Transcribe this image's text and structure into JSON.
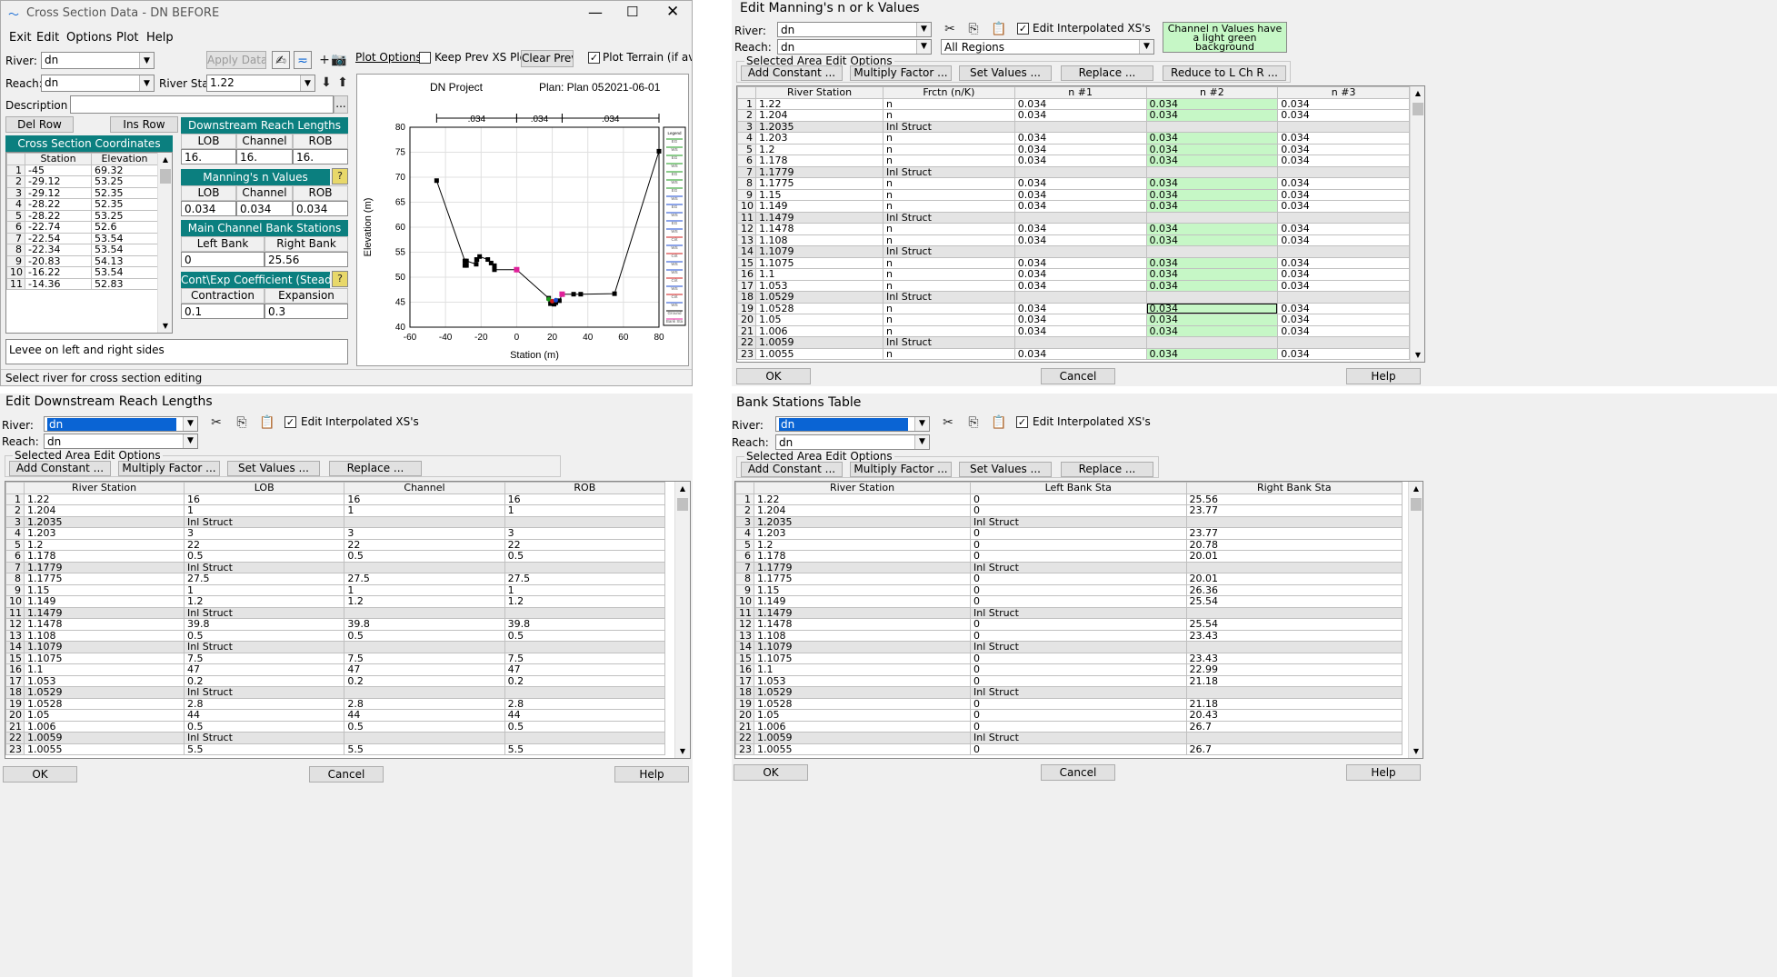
{
  "xs": {
    "title": "Cross Section Data - DN BEFORE",
    "menu": [
      "Exit",
      "Edit",
      "Options",
      "Plot",
      "Help"
    ],
    "river_label": "River:",
    "river": "dn",
    "reach_label": "Reach:",
    "reach": "dn",
    "river_sta_label": "River Sta.:",
    "river_sta": "1.22",
    "apply": "Apply Data",
    "plot_options": "Plot Options",
    "keep_prev": "Keep Prev XS Plots",
    "clear_prev": "Clear Prev",
    "plot_terrain": "Plot Terrain (if availab",
    "description_label": "Description",
    "del_row": "Del Row",
    "ins_row": "Ins Row",
    "coords_header": "Cross Section Coordinates",
    "coords_cols": [
      "Station",
      "Elevation"
    ],
    "coords": [
      [
        "-45",
        "69.32"
      ],
      [
        "-29.12",
        "53.25"
      ],
      [
        "-29.12",
        "52.35"
      ],
      [
        "-28.22",
        "52.35"
      ],
      [
        "-28.22",
        "53.25"
      ],
      [
        "-22.74",
        "52.6"
      ],
      [
        "-22.54",
        "53.54"
      ],
      [
        "-22.34",
        "53.54"
      ],
      [
        "-20.83",
        "54.13"
      ],
      [
        "-16.22",
        "53.54"
      ],
      [
        "-14.36",
        "52.83"
      ]
    ],
    "drl_header": "Downstream Reach Lengths",
    "drl_cols": [
      "LOB",
      "Channel",
      "ROB"
    ],
    "drl_vals": [
      "16.",
      "16.",
      "16."
    ],
    "mn_header": "Manning's n Values",
    "mn_cols": [
      "LOB",
      "Channel",
      "ROB"
    ],
    "mn_vals": [
      "0.034",
      "0.034",
      "0.034"
    ],
    "bank_header": "Main Channel Bank Stations",
    "bank_cols": [
      "Left Bank",
      "Right Bank"
    ],
    "bank_vals": [
      "0",
      "25.56"
    ],
    "ce_header": "Cont\\Exp Coefficient (Steady",
    "ce_cols": [
      "Contraction",
      "Expansion"
    ],
    "ce_vals": [
      "0.1",
      "0.3"
    ],
    "note": "Levee on left and right sides",
    "status": "Select river for cross section editing"
  },
  "chart_data": {
    "type": "line",
    "title_parts": [
      "DN Project",
      "Plan: Plan 05",
      "2021-06-01"
    ],
    "xlabel": "Station (m)",
    "ylabel": "Elevation (m)",
    "xlim": [
      -60,
      80
    ],
    "ylim": [
      40,
      80
    ],
    "xticks": [
      -60,
      -40,
      -20,
      0,
      20,
      40,
      60,
      80
    ],
    "yticks": [
      40,
      45,
      50,
      55,
      60,
      65,
      70,
      75,
      80
    ],
    "n_labels": [
      ".034",
      ".034",
      ".034"
    ],
    "n_breaks": [
      -45,
      0,
      25.56,
      80
    ],
    "grid": true,
    "legend": "right",
    "series": [
      {
        "x": [
          -45,
          -29.12,
          -29.12,
          -28.22,
          -28.22,
          -22.74,
          -22.54,
          -22.34,
          -20.83,
          -16.22,
          -14.36,
          -12.5,
          -12.5,
          0,
          18,
          19,
          20,
          21,
          22,
          24,
          25.56,
          32,
          36,
          55,
          80
        ],
        "y": [
          69.32,
          53.25,
          52.35,
          52.35,
          53.25,
          52.6,
          53.54,
          53.54,
          54.13,
          53.54,
          52.83,
          52.3,
          51.5,
          51.5,
          45.8,
          44.7,
          44.8,
          44.6,
          44.9,
          45.3,
          46.6,
          46.6,
          46.6,
          46.7,
          75.2
        ]
      }
    ],
    "bank_points_x": [
      0,
      25.56
    ],
    "legend_items": [
      "Legend",
      "EG",
      "WS",
      "EG",
      "WS",
      "EG",
      "WS",
      "EG",
      "WS",
      "EG",
      "WS",
      "EG",
      "WS",
      "Crit",
      "WS",
      "Crit",
      "WS",
      "WS",
      "Crit",
      "WS",
      "Crit",
      "WS",
      "Ground",
      "Bank Sta"
    ]
  },
  "mn": {
    "title": "Edit Manning's n or k Values",
    "river_label": "River:",
    "river": "dn",
    "reach_label": "Reach:",
    "reach": "dn",
    "edit_interp": "Edit Interpolated XS's",
    "regions": "All Regions",
    "note": "Channel n Values have a light green background",
    "sel_area": "Selected Area Edit Options",
    "buttons": [
      "Add Constant ...",
      "Multiply Factor ...",
      "Set Values ...",
      "Replace ...",
      "Reduce to L Ch R ..."
    ],
    "cols": [
      "River Station",
      "Frctn (n/K)",
      "n #1",
      "n #2",
      "n #3"
    ],
    "rows": [
      [
        "1.22",
        "n",
        "0.034",
        "0.034",
        "0.034"
      ],
      [
        "1.204",
        "n",
        "0.034",
        "0.034",
        "0.034"
      ],
      [
        "1.2035",
        "Inl Struct",
        "",
        "",
        ""
      ],
      [
        "1.203",
        "n",
        "0.034",
        "0.034",
        "0.034"
      ],
      [
        "1.2",
        "n",
        "0.034",
        "0.034",
        "0.034"
      ],
      [
        "1.178",
        "n",
        "0.034",
        "0.034",
        "0.034"
      ],
      [
        "1.1779",
        "Inl Struct",
        "",
        "",
        ""
      ],
      [
        "1.1775",
        "n",
        "0.034",
        "0.034",
        "0.034"
      ],
      [
        "1.15",
        "n",
        "0.034",
        "0.034",
        "0.034"
      ],
      [
        "1.149",
        "n",
        "0.034",
        "0.034",
        "0.034"
      ],
      [
        "1.1479",
        "Inl Struct",
        "",
        "",
        ""
      ],
      [
        "1.1478",
        "n",
        "0.034",
        "0.034",
        "0.034"
      ],
      [
        "1.108",
        "n",
        "0.034",
        "0.034",
        "0.034"
      ],
      [
        "1.1079",
        "Inl Struct",
        "",
        "",
        ""
      ],
      [
        "1.1075",
        "n",
        "0.034",
        "0.034",
        "0.034"
      ],
      [
        "1.1",
        "n",
        "0.034",
        "0.034",
        "0.034"
      ],
      [
        "1.053",
        "n",
        "0.034",
        "0.034",
        "0.034"
      ],
      [
        "1.0529",
        "Inl Struct",
        "",
        "",
        ""
      ],
      [
        "1.0528",
        "n",
        "0.034",
        "0.034",
        "0.034"
      ],
      [
        "1.05",
        "n",
        "0.034",
        "0.034",
        "0.034"
      ],
      [
        "1.006",
        "n",
        "0.034",
        "0.034",
        "0.034"
      ],
      [
        "1.0059",
        "Inl Struct",
        "",
        "",
        ""
      ],
      [
        "1.0055",
        "n",
        "0.034",
        "0.034",
        "0.034"
      ]
    ],
    "ok": "OK",
    "cancel": "Cancel",
    "help": "Help"
  },
  "drl": {
    "title": "Edit Downstream Reach Lengths",
    "river_label": "River:",
    "river": "dn",
    "reach_label": "Reach:",
    "reach": "dn",
    "edit_interp": "Edit Interpolated XS's",
    "sel_area": "Selected Area Edit Options",
    "buttons": [
      "Add Constant ...",
      "Multiply Factor ...",
      "Set Values ...",
      "Replace ..."
    ],
    "cols": [
      "River Station",
      "LOB",
      "Channel",
      "ROB"
    ],
    "rows": [
      [
        "1.22",
        "16",
        "16",
        "16"
      ],
      [
        "1.204",
        "1",
        "1",
        "1"
      ],
      [
        "1.2035",
        "Inl Struct",
        "",
        ""
      ],
      [
        "1.203",
        "3",
        "3",
        "3"
      ],
      [
        "1.2",
        "22",
        "22",
        "22"
      ],
      [
        "1.178",
        "0.5",
        "0.5",
        "0.5"
      ],
      [
        "1.1779",
        "Inl Struct",
        "",
        ""
      ],
      [
        "1.1775",
        "27.5",
        "27.5",
        "27.5"
      ],
      [
        "1.15",
        "1",
        "1",
        "1"
      ],
      [
        "1.149",
        "1.2",
        "1.2",
        "1.2"
      ],
      [
        "1.1479",
        "Inl Struct",
        "",
        ""
      ],
      [
        "1.1478",
        "39.8",
        "39.8",
        "39.8"
      ],
      [
        "1.108",
        "0.5",
        "0.5",
        "0.5"
      ],
      [
        "1.1079",
        "Inl Struct",
        "",
        ""
      ],
      [
        "1.1075",
        "7.5",
        "7.5",
        "7.5"
      ],
      [
        "1.1",
        "47",
        "47",
        "47"
      ],
      [
        "1.053",
        "0.2",
        "0.2",
        "0.2"
      ],
      [
        "1.0529",
        "Inl Struct",
        "",
        ""
      ],
      [
        "1.0528",
        "2.8",
        "2.8",
        "2.8"
      ],
      [
        "1.05",
        "44",
        "44",
        "44"
      ],
      [
        "1.006",
        "0.5",
        "0.5",
        "0.5"
      ],
      [
        "1.0059",
        "Inl Struct",
        "",
        ""
      ],
      [
        "1.0055",
        "5.5",
        "5.5",
        "5.5"
      ]
    ],
    "ok": "OK",
    "cancel": "Cancel",
    "help": "Help"
  },
  "bank": {
    "title": "Bank Stations Table",
    "river_label": "River:",
    "river": "dn",
    "reach_label": "Reach:",
    "reach": "dn",
    "edit_interp": "Edit Interpolated XS's",
    "sel_area": "Selected Area Edit Options",
    "buttons": [
      "Add Constant ...",
      "Multiply Factor ...",
      "Set Values ...",
      "Replace ..."
    ],
    "cols": [
      "River Station",
      "Left Bank Sta",
      "Right Bank Sta"
    ],
    "rows": [
      [
        "1.22",
        "0",
        "25.56"
      ],
      [
        "1.204",
        "0",
        "23.77"
      ],
      [
        "1.2035",
        "Inl Struct",
        ""
      ],
      [
        "1.203",
        "0",
        "23.77"
      ],
      [
        "1.2",
        "0",
        "20.78"
      ],
      [
        "1.178",
        "0",
        "20.01"
      ],
      [
        "1.1779",
        "Inl Struct",
        ""
      ],
      [
        "1.1775",
        "0",
        "20.01"
      ],
      [
        "1.15",
        "0",
        "26.36"
      ],
      [
        "1.149",
        "0",
        "25.54"
      ],
      [
        "1.1479",
        "Inl Struct",
        ""
      ],
      [
        "1.1478",
        "0",
        "25.54"
      ],
      [
        "1.108",
        "0",
        "23.43"
      ],
      [
        "1.1079",
        "Inl Struct",
        ""
      ],
      [
        "1.1075",
        "0",
        "23.43"
      ],
      [
        "1.1",
        "0",
        "22.99"
      ],
      [
        "1.053",
        "0",
        "21.18"
      ],
      [
        "1.0529",
        "Inl Struct",
        ""
      ],
      [
        "1.0528",
        "0",
        "21.18"
      ],
      [
        "1.05",
        "0",
        "20.43"
      ],
      [
        "1.006",
        "0",
        "26.7"
      ],
      [
        "1.0059",
        "Inl Struct",
        ""
      ],
      [
        "1.0055",
        "0",
        "26.7"
      ]
    ],
    "ok": "OK",
    "cancel": "Cancel",
    "help": "Help"
  }
}
